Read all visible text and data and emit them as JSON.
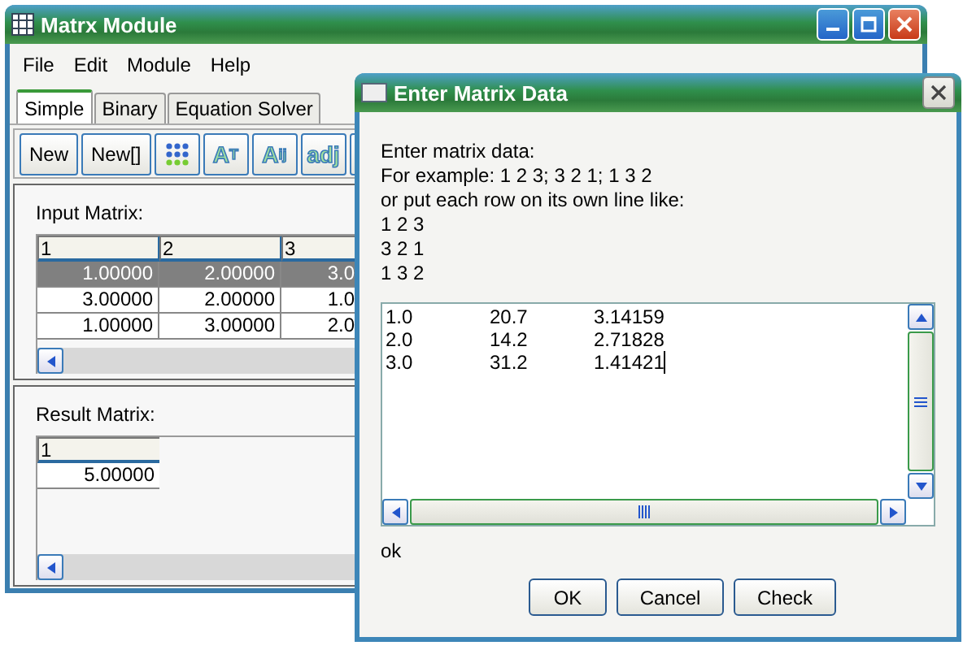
{
  "main_window": {
    "title": "Matrx Module",
    "menu": [
      "File",
      "Edit",
      "Module",
      "Help"
    ],
    "tabs": [
      {
        "label": "Simple",
        "selected": true
      },
      {
        "label": "Binary",
        "selected": false
      },
      {
        "label": "Equation Solver",
        "selected": false
      }
    ],
    "toolbar": [
      {
        "kind": "text",
        "label": "New"
      },
      {
        "kind": "text",
        "label": "New[]"
      },
      {
        "kind": "grid"
      },
      {
        "kind": "glyph",
        "text": "A",
        "sup": "T"
      },
      {
        "kind": "glyph",
        "text": "A",
        "sub": "ij"
      },
      {
        "kind": "glyph",
        "text": "adj"
      },
      {
        "kind": "partial"
      }
    ],
    "input_matrix": {
      "label": "Input Matrix:",
      "columns": [
        "1",
        "2",
        "3"
      ],
      "rows": [
        {
          "cells": [
            "1.00000",
            "2.00000",
            "3.0"
          ],
          "selected": true
        },
        {
          "cells": [
            "3.00000",
            "2.00000",
            "1.0"
          ],
          "selected": false
        },
        {
          "cells": [
            "1.00000",
            "3.00000",
            "2.0"
          ],
          "selected": false
        }
      ]
    },
    "result_matrix": {
      "label": "Result Matrix:",
      "columns": [
        "1"
      ],
      "rows": [
        {
          "cells": [
            "5.00000"
          ],
          "selected": false
        }
      ]
    }
  },
  "dialog": {
    "title": "Enter Matrix Data",
    "instructions": [
      "Enter matrix data:",
      "For example: 1 2 3; 3 2 1; 1 3 2",
      "or put each row on its own line like:",
      "1 2 3",
      "3 2 1",
      "1 3 2"
    ],
    "data_lines": [
      [
        "1.0",
        "20.7",
        "3.14159"
      ],
      [
        "2.0",
        "14.2",
        "2.71828"
      ],
      [
        "3.0",
        "31.2",
        "1.41421"
      ]
    ],
    "status": "ok",
    "buttons": [
      "OK",
      "Cancel",
      "Check"
    ]
  }
}
